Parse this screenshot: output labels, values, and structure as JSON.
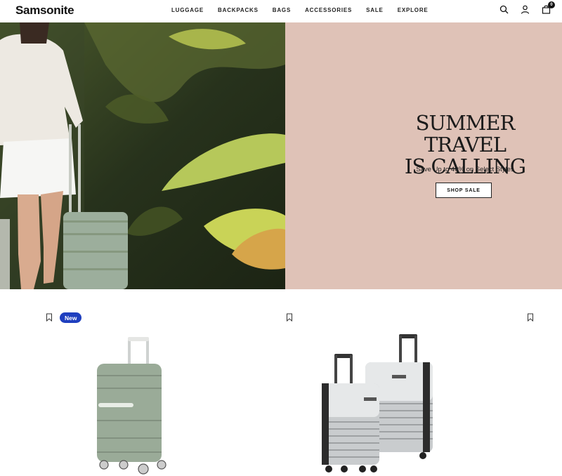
{
  "header": {
    "logo": "Samsonite",
    "nav": [
      "LUGGAGE",
      "BACKPACKS",
      "BAGS",
      "ACCESSORIES",
      "SALE",
      "EXPLORE"
    ],
    "cart_count": "0"
  },
  "hero": {
    "headline_line1": "SUMMER TRAVEL",
    "headline_line2": "IS CALLING",
    "subtitle": "Save Up to 40% on Select Styles",
    "cta": "SHOP SALE",
    "panel_color": "#dfc2b7"
  },
  "products": [
    {
      "badge": "New",
      "icon": "bookmark-icon",
      "color": "sage-green"
    },
    {
      "icon": "bookmark-icon",
      "color": "silver"
    },
    {
      "icon": "bookmark-icon"
    }
  ]
}
